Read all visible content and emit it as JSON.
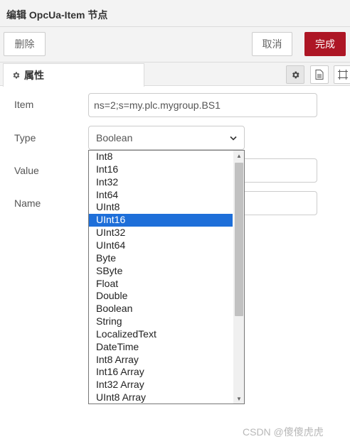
{
  "header": {
    "title": "编辑 OpcUa-Item 节点"
  },
  "toolbar": {
    "delete_label": "删除",
    "cancel_label": "取消",
    "done_label": "完成"
  },
  "tabs": {
    "properties_label": "属性",
    "icons": [
      "gear-icon",
      "document-icon",
      "frame-icon"
    ]
  },
  "form": {
    "item_label": "Item",
    "item_value": "ns=2;s=my.plc.mygroup.BS1",
    "type_label": "Type",
    "type_value": "Boolean",
    "value_label": "Value",
    "name_label": "Name"
  },
  "dropdown": {
    "options": [
      "Int8",
      "Int16",
      "Int32",
      "Int64",
      "UInt8",
      "UInt16",
      "UInt32",
      "UInt64",
      "Byte",
      "SByte",
      "Float",
      "Double",
      "Boolean",
      "String",
      "LocalizedText",
      "DateTime",
      "Int8 Array",
      "Int16 Array",
      "Int32 Array",
      "UInt8 Array"
    ],
    "highlighted": "UInt16"
  },
  "watermark": "CSDN @傻傻虎虎",
  "colors": {
    "accent": "#ad1625",
    "highlight": "#1e6fd9"
  }
}
